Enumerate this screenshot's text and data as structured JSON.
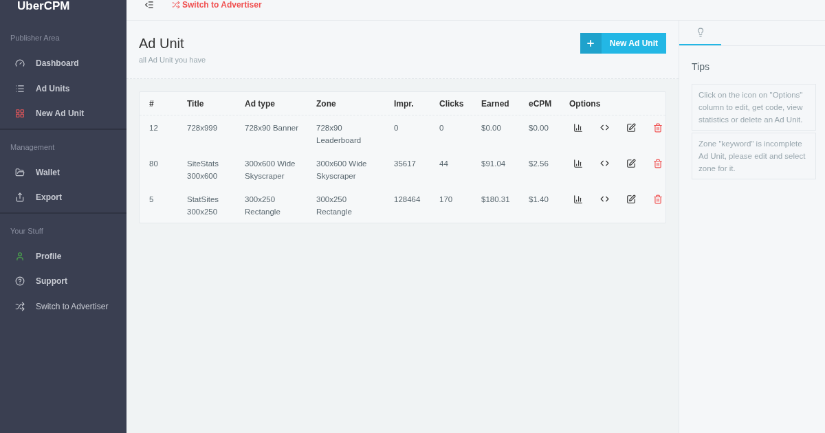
{
  "sidebar": {
    "logo": "UberCPM",
    "sections": [
      {
        "title": "Publisher Area",
        "items": [
          {
            "label": "Dashboard"
          },
          {
            "label": "Ad Units"
          },
          {
            "label": "New Ad Unit"
          }
        ]
      },
      {
        "title": "Management",
        "items": [
          {
            "label": "Wallet"
          },
          {
            "label": "Export"
          }
        ]
      },
      {
        "title": "Your Stuff",
        "items": [
          {
            "label": "Profile"
          },
          {
            "label": "Support"
          },
          {
            "label": "Switch to Advertiser"
          }
        ]
      }
    ]
  },
  "topbar": {
    "link": "Switch to Advertiser"
  },
  "header": {
    "title": "Ad Unit",
    "subtitle": "all Ad Unit you have",
    "button": "New Ad Unit"
  },
  "table": {
    "columns": [
      "#",
      "Title",
      "Ad type",
      "Zone",
      "Impr.",
      "Clicks",
      "Earned",
      "eCPM",
      "Options"
    ],
    "rows": [
      [
        "12",
        "728x999",
        "728x90 Banner",
        "728x90 Leaderboard",
        "0",
        "0",
        "$0.00",
        "$0.00"
      ],
      [
        "80",
        "SiteStats 300x600",
        "300x600 Wide Skyscraper",
        "300x600 Wide Skyscraper",
        "35617",
        "44",
        "$91.04",
        "$2.56"
      ],
      [
        "5",
        "StatSites 300x250",
        "300x250 Rectangle",
        "300x250 Rectangle",
        "128464",
        "170",
        "$180.31",
        "$1.40"
      ]
    ]
  },
  "tips": {
    "tab_selected": true,
    "title": "Tips",
    "items": [
      "Click on the icon on \"Options\" column to edit, get code, view statistics or delete an Ad Unit.",
      "Zone \"keyword\" is incomplete Ad Unit, please edit and select zone for it."
    ]
  }
}
